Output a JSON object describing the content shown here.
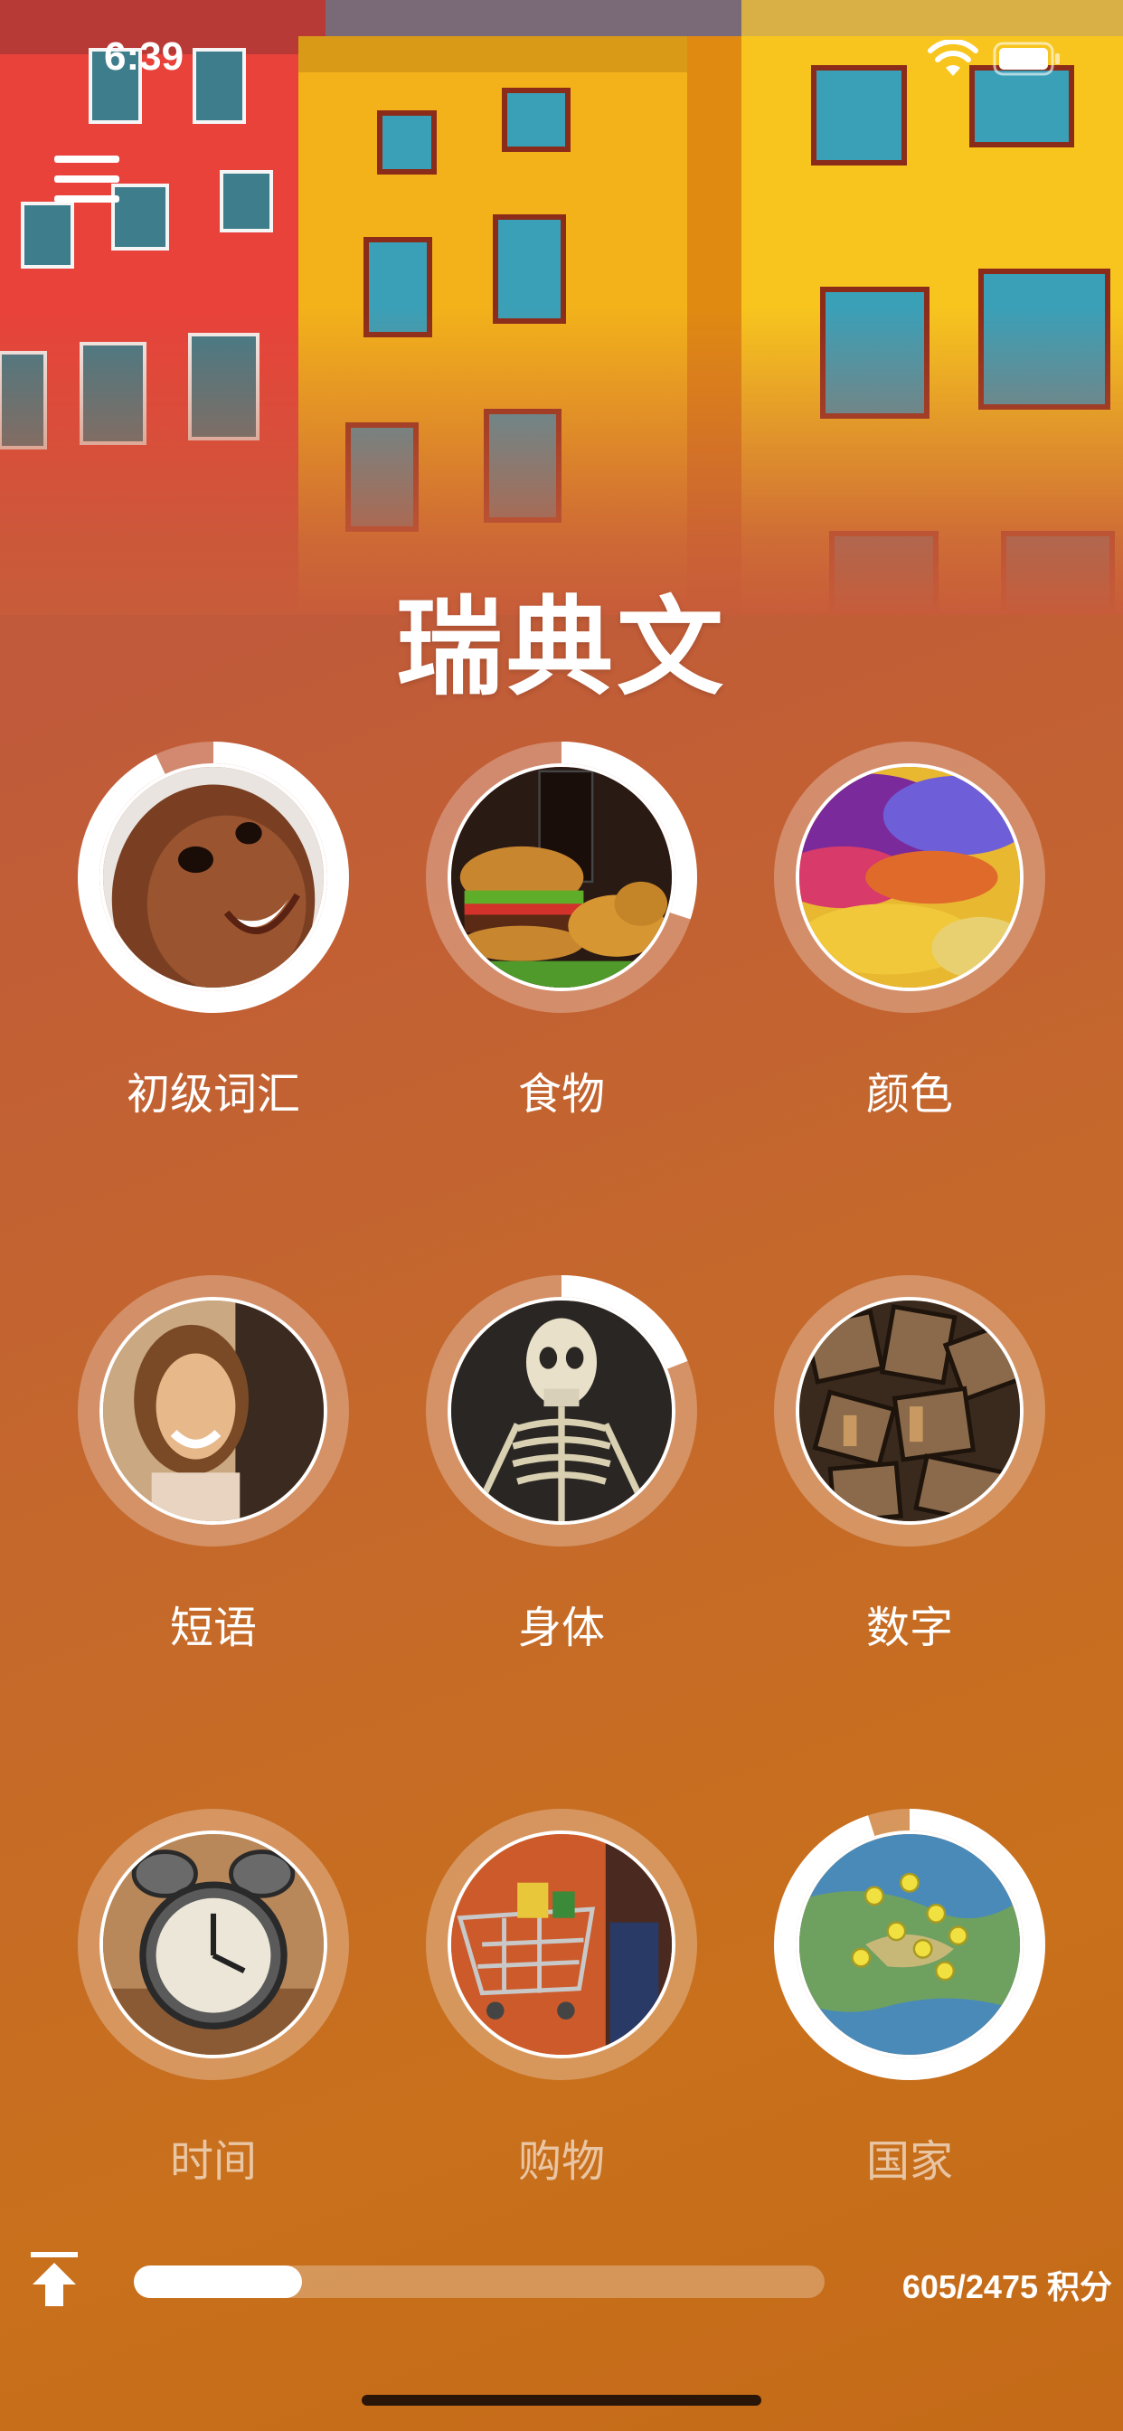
{
  "status_bar": {
    "time": "6:39"
  },
  "page": {
    "title": "瑞典文"
  },
  "topics": [
    {
      "label": "初级词汇",
      "progress": 0.93,
      "dimmed": false,
      "icon": "baby-face-photo"
    },
    {
      "label": "食物",
      "progress": 0.3,
      "dimmed": false,
      "icon": "burger-food-photo"
    },
    {
      "label": "颜色",
      "progress": 0,
      "dimmed": false,
      "icon": "color-powder-photo"
    },
    {
      "label": "短语",
      "progress": 0,
      "dimmed": false,
      "icon": "smiling-woman-photo"
    },
    {
      "label": "身体",
      "progress": 0.19,
      "dimmed": false,
      "icon": "skeleton-photo"
    },
    {
      "label": "数字",
      "progress": 0,
      "dimmed": false,
      "icon": "wooden-numbers-photo"
    },
    {
      "label": "时间",
      "progress": 0,
      "dimmed": true,
      "icon": "alarm-clock-photo"
    },
    {
      "label": "购物",
      "progress": 0,
      "dimmed": true,
      "icon": "shopping-cart-photo"
    },
    {
      "label": "国家",
      "progress": 0.95,
      "dimmed": true,
      "icon": "map-pins-photo"
    }
  ],
  "footer": {
    "progress_fraction": 0.244,
    "points_text": "605/2475 积分"
  },
  "colors": {
    "background_top": "#c75a3c",
    "background_bottom": "#c8701c",
    "ring_track": "rgba(255,255,255,0.28)",
    "ring_fill": "#ffffff"
  }
}
